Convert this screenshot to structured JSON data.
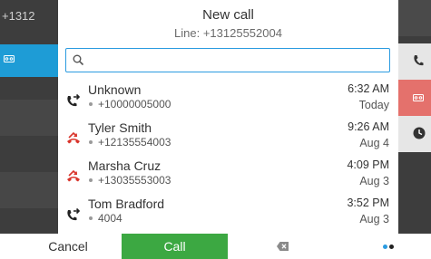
{
  "background": {
    "left_line_text": "+1312"
  },
  "dialog": {
    "title": "New call",
    "subtitle": "Line: +13125552004",
    "search": {
      "value": "",
      "placeholder": ""
    }
  },
  "calls": [
    {
      "name": "Unknown",
      "number": "+10000005000",
      "time": "6:32 AM",
      "date": "Today",
      "type": "outgoing",
      "icon": "outgoing-call-icon"
    },
    {
      "name": "Tyler Smith",
      "number": "+12135554003",
      "time": "9:26 AM",
      "date": "Aug 4",
      "type": "missed",
      "icon": "missed-call-icon"
    },
    {
      "name": "Marsha Cruz",
      "number": "+13035553003",
      "time": "4:09 PM",
      "date": "Aug 3",
      "type": "missed",
      "icon": "missed-call-icon"
    },
    {
      "name": "Tom Bradford",
      "number": "4004",
      "time": "3:52 PM",
      "date": "Aug 3",
      "type": "outgoing",
      "icon": "outgoing-call-icon"
    }
  ],
  "softkeys": {
    "cancel": "Cancel",
    "call": "Call",
    "backspace_icon": "backspace-icon",
    "more_icon": "more-dots-icon"
  },
  "colors": {
    "accent": "#2b9be0",
    "call_green": "#3ca842",
    "missed_red": "#d9342b",
    "voicemail_blue": "#1e9cd6",
    "voicemail_red": "#e4716c"
  }
}
